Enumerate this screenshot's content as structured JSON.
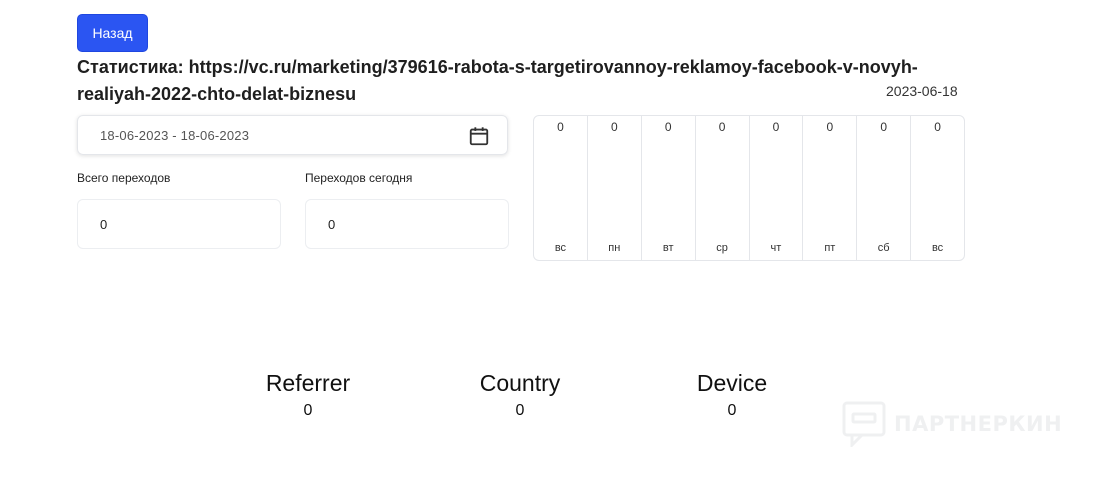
{
  "header": {
    "back_label": "Назад",
    "title": "Статистика: https://vc.ru/marketing/379616-rabota-s-targetirovannoy-reklamoy-facebook-v-novyh-realiyah-2022-chto-delat-biznesu",
    "date": "2023-06-18"
  },
  "filters": {
    "date_range": "18-06-2023 - 18-06-2023",
    "calendar_icon": "calendar-icon"
  },
  "stats": {
    "total_label": "Всего переходов",
    "total_value": "0",
    "today_label": "Переходов сегодня",
    "today_value": "0"
  },
  "week": {
    "days": [
      {
        "name": "вс",
        "value": "0"
      },
      {
        "name": "пн",
        "value": "0"
      },
      {
        "name": "вт",
        "value": "0"
      },
      {
        "name": "ср",
        "value": "0"
      },
      {
        "name": "чт",
        "value": "0"
      },
      {
        "name": "пт",
        "value": "0"
      },
      {
        "name": "сб",
        "value": "0"
      },
      {
        "name": "вс",
        "value": "0"
      }
    ]
  },
  "metrics": {
    "referrer": {
      "title": "Referrer",
      "value": "0"
    },
    "country": {
      "title": "Country",
      "value": "0"
    },
    "device": {
      "title": "Device",
      "value": "0"
    }
  },
  "watermark": {
    "text": "ПАРТНЕРКИН"
  },
  "colors": {
    "accent": "#2b55f2",
    "border": "#e4e6ea"
  }
}
